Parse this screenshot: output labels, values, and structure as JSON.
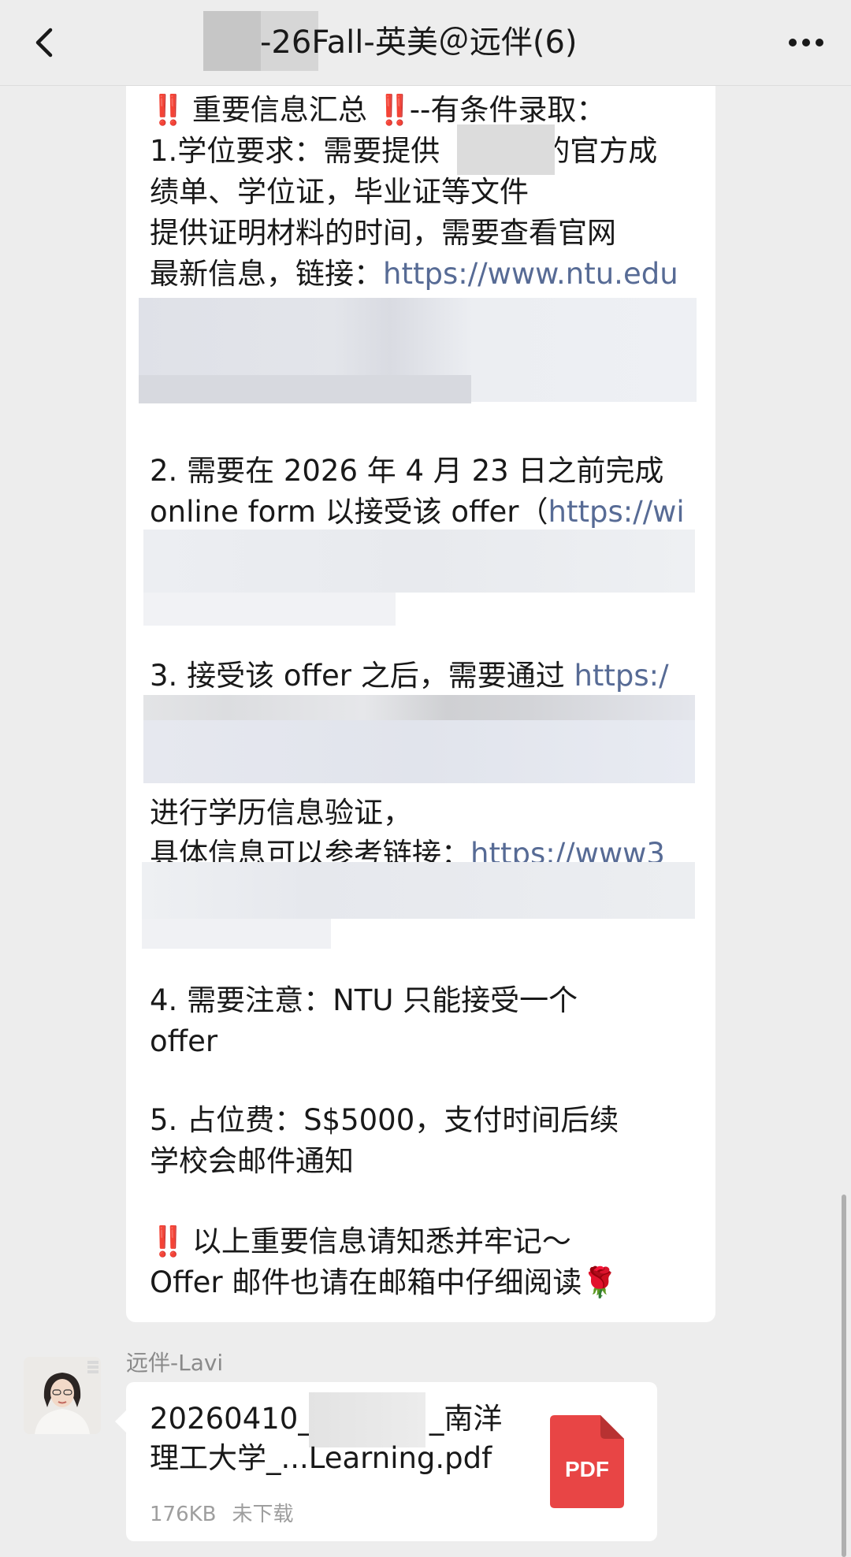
{
  "header": {
    "title": "-26Fall-英美＠远伴(6)",
    "back_icon": "chevron-left-icon",
    "more_icon": "more-dots-icon"
  },
  "message": {
    "lines": [
      {
        "mark": "‼️",
        "text": " 重要信息汇总 ",
        "mark2": "‼️",
        "text2": "--有条件录取："
      },
      {
        "text": "1.学位要求：需要提供",
        "text2": "的官方成"
      },
      {
        "text": "绩单、学位证，毕业证等文件"
      },
      {
        "text": "提供证明材料的时间，需要查看官网"
      },
      {
        "text": "最新信息，链接：",
        "link": "https://www.ntu.edu"
      },
      {
        "text": "2. 需要在 2026 年 4 月 23 日之前完成"
      },
      {
        "text": "online form 以接受该 offer（",
        "link": "https://wi"
      },
      {
        "text": "3. 接受该 offer 之后，需要通过 ",
        "link": "https:/"
      },
      {
        "text": "进行学历信息验证，"
      },
      {
        "text": "具体信息可以参考链接：",
        "link": "https://www3"
      },
      {
        "text": "4. 需要注意：NTU 只能接受一个"
      },
      {
        "text": "offer"
      },
      {
        "text": "5. 占位费：S$5000，支付时间后续"
      },
      {
        "text": "学校会邮件通知"
      },
      {
        "mark": "‼️",
        "text": " 以上重要信息请知悉并牢记～"
      },
      {
        "text": "Offer 邮件也请在邮箱中仔细阅读",
        "emoji": "🌹"
      }
    ]
  },
  "sender": {
    "name": "远伴-Lavi"
  },
  "file": {
    "line1_prefix": "20260410_",
    "line1_suffix": "_南洋",
    "line2": "理工大学_...Learning.pdf",
    "size": "176KB",
    "status": "未下载",
    "icon_label": "PDF",
    "icon_color": "#e84545"
  },
  "colors": {
    "link": "#576b95",
    "background": "#ededed",
    "bubble": "#ffffff",
    "warning": "#e4322d"
  }
}
